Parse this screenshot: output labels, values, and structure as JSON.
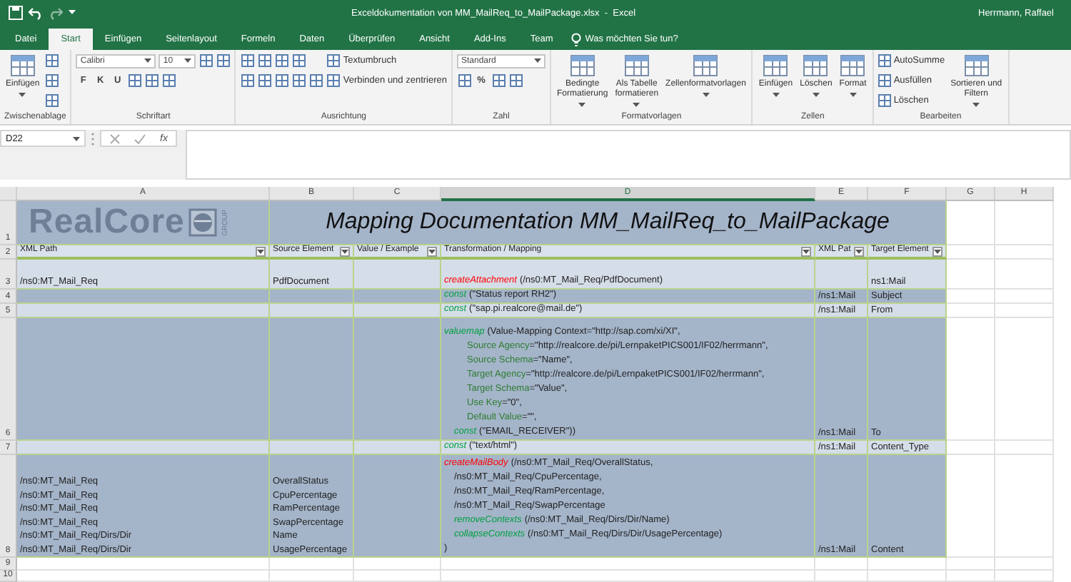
{
  "window": {
    "title": "Exceldokumentation von MM_MailReq_to_MailPackage.xlsx  -  Excel",
    "user": "Herrmann, Raffael"
  },
  "tabs": [
    {
      "label": "Datei",
      "selected": false
    },
    {
      "label": "Start",
      "selected": true
    },
    {
      "label": "Einfügen",
      "selected": false
    },
    {
      "label": "Seitenlayout",
      "selected": false
    },
    {
      "label": "Formeln",
      "selected": false
    },
    {
      "label": "Daten",
      "selected": false
    },
    {
      "label": "Überprüfen",
      "selected": false
    },
    {
      "label": "Ansicht",
      "selected": false
    },
    {
      "label": "Add-Ins",
      "selected": false
    },
    {
      "label": "Team",
      "selected": false
    }
  ],
  "tell_me": {
    "placeholder": "Was möchten Sie tun?"
  },
  "ribbon": {
    "groups": [
      {
        "label": "Zwischenablage",
        "controls": [
          {
            "kind": "big",
            "lines": [
              "Einfügen"
            ]
          },
          {
            "kind": "stack",
            "rows": [
              {
                "items": [
                  {
                    "kind": "tool"
                  }
                ]
              },
              {
                "items": [
                  {
                    "kind": "tool"
                  }
                ]
              },
              {
                "items": [
                  {
                    "kind": "tool"
                  }
                ]
              }
            ]
          }
        ]
      },
      {
        "label": "Schriftart",
        "controls": [
          {
            "kind": "stack",
            "rows": [
              {
                "items": [
                  {
                    "kind": "field",
                    "value": "Calibri"
                  },
                  {
                    "kind": "field",
                    "value": "10"
                  },
                  {
                    "kind": "tool"
                  },
                  {
                    "kind": "tool"
                  }
                ]
              },
              {
                "items": [
                  {
                    "kind": "letter",
                    "text": "F"
                  },
                  {
                    "kind": "letter",
                    "text": "K"
                  },
                  {
                    "kind": "letter",
                    "text": "U"
                  },
                  {
                    "kind": "tool"
                  },
                  {
                    "kind": "tool"
                  },
                  {
                    "kind": "tool"
                  }
                ]
              }
            ]
          }
        ]
      },
      {
        "label": "Ausrichtung",
        "controls": [
          {
            "kind": "stack",
            "rows": [
              {
                "items": [
                  {
                    "kind": "tool"
                  },
                  {
                    "kind": "tool"
                  },
                  {
                    "kind": "tool"
                  },
                  {
                    "kind": "tool"
                  }
                ]
              },
              {
                "items": [
                  {
                    "kind": "tool"
                  },
                  {
                    "kind": "tool"
                  },
                  {
                    "kind": "tool"
                  },
                  {
                    "kind": "tool"
                  },
                  {
                    "kind": "tool"
                  }
                ]
              }
            ]
          },
          {
            "kind": "stack",
            "rows": [
              {
                "items": [
                  {
                    "kind": "small",
                    "label": "Textumbruch"
                  }
                ]
              },
              {
                "items": [
                  {
                    "kind": "small",
                    "label": "Verbinden und zentrieren"
                  }
                ]
              }
            ]
          }
        ]
      },
      {
        "label": "Zahl",
        "controls": [
          {
            "kind": "stack",
            "rows": [
              {
                "items": [
                  {
                    "kind": "field",
                    "value": "Standard"
                  }
                ]
              },
              {
                "items": [
                  {
                    "kind": "tool"
                  },
                  {
                    "kind": "letter",
                    "text": "%"
                  },
                  {
                    "kind": "tool"
                  },
                  {
                    "kind": "tool"
                  }
                ]
              }
            ]
          }
        ]
      },
      {
        "label": "Formatvorlagen",
        "controls": [
          {
            "kind": "big",
            "lines": [
              "Bedingte",
              "Formatierung"
            ]
          },
          {
            "kind": "big",
            "lines": [
              "Als Tabelle",
              "formatieren"
            ]
          },
          {
            "kind": "big",
            "lines": [
              "Zellenformatvorlagen"
            ]
          }
        ]
      },
      {
        "label": "Zellen",
        "controls": [
          {
            "kind": "big",
            "lines": [
              "Einfügen"
            ]
          },
          {
            "kind": "big",
            "lines": [
              "Löschen"
            ]
          },
          {
            "kind": "big",
            "lines": [
              "Format"
            ]
          }
        ]
      },
      {
        "label": "Bearbeiten",
        "controls": [
          {
            "kind": "stack",
            "rows": [
              {
                "items": [
                  {
                    "kind": "small",
                    "label": "AutoSumme"
                  }
                ]
              },
              {
                "items": [
                  {
                    "kind": "small",
                    "label": "Ausfüllen"
                  }
                ]
              },
              {
                "items": [
                  {
                    "kind": "small",
                    "label": "Löschen"
                  }
                ]
              }
            ]
          },
          {
            "kind": "big",
            "lines": [
              "Sortieren und",
              "Filtern"
            ]
          }
        ]
      }
    ]
  },
  "formula_bar": {
    "name_box": "D22",
    "function_button": "fx"
  },
  "sheet": {
    "columns": [
      {
        "label": "A",
        "selected": false
      },
      {
        "label": "B",
        "selected": false
      },
      {
        "label": "C",
        "selected": false
      },
      {
        "label": "D",
        "selected": true
      },
      {
        "label": "E",
        "selected": false
      },
      {
        "label": "F",
        "selected": false
      },
      {
        "label": "G",
        "selected": false
      },
      {
        "label": "H",
        "selected": false
      }
    ],
    "rows": [
      {
        "number": "1",
        "kind": "banner",
        "logo": {
          "wordmark": "RealCore",
          "tagline": "GROUP"
        },
        "title": "Mapping Documentation MM_MailReq_to_MailPackage"
      },
      {
        "number": "2",
        "kind": "header",
        "cells": [
          "XML Path",
          "Source Element",
          "Value / Example",
          "Transformation / Mapping",
          "XML Pat",
          "Target Element"
        ]
      },
      {
        "number": "3",
        "kind": "data",
        "xml_path": [
          "/ns0:MT_Mail_Req"
        ],
        "source_element": [
          "PdfDocument"
        ],
        "mapping": [
          {
            "kind": "call",
            "func": "createAttachment",
            "color": "#ff0000",
            "args": "(/ns0:MT_Mail_Req/PdfDocument)"
          }
        ],
        "target_element": "ns1:Mail"
      },
      {
        "number": "4",
        "kind": "data",
        "mapping": [
          {
            "kind": "call",
            "func": "const",
            "color": "#00a040",
            "args": "(\"Status report RH2\")"
          }
        ],
        "target_path": "/ns1:Mail",
        "target_element": "Subject"
      },
      {
        "number": "5",
        "kind": "data",
        "mapping": [
          {
            "kind": "call",
            "func": "const",
            "color": "#00a040",
            "args": "(\"sap.pi.realcore@mail.de\")"
          }
        ],
        "target_path": "/ns1:Mail",
        "target_element": "From"
      },
      {
        "number": "6",
        "kind": "data",
        "mapping": [
          {
            "kind": "call",
            "func": "valuemap",
            "color": "#00a040",
            "args": "(Value-Mapping Context=\"http://sap.com/xi/XI\","
          },
          {
            "kind": "param",
            "name": "Source Agency",
            "value": "=\"http://realcore.de/pi/LernpaketPICS001/IF02/herrmann\","
          },
          {
            "kind": "param",
            "name": "Source Schema",
            "value": "=\"Name\","
          },
          {
            "kind": "param",
            "name": "Target Agency",
            "value": "=\"http://realcore.de/pi/LernpaketPICS001/IF02/herrmann\","
          },
          {
            "kind": "param",
            "name": "Target Schema",
            "value": "=\"Value\","
          },
          {
            "kind": "param",
            "name": "Use Key",
            "value": "=\"0\","
          },
          {
            "kind": "param",
            "name": "Default Value",
            "value": "=\"\","
          },
          {
            "kind": "nested_call",
            "func": "const",
            "color": "#00a040",
            "args": "(\"EMAIL_RECEIVER\"))"
          }
        ],
        "target_path": "/ns1:Mail",
        "target_element": "To"
      },
      {
        "number": "7",
        "kind": "data",
        "mapping": [
          {
            "kind": "call",
            "func": "const",
            "color": "#00a040",
            "args": "(\"text/html\")"
          }
        ],
        "target_path": "/ns1:Mail",
        "target_element": "Content_Type"
      },
      {
        "number": "8",
        "kind": "data",
        "xml_path": [
          "/ns0:MT_Mail_Req",
          "/ns0:MT_Mail_Req",
          "/ns0:MT_Mail_Req",
          "/ns0:MT_Mail_Req",
          "/ns0:MT_Mail_Req/Dirs/Dir",
          "/ns0:MT_Mail_Req/Dirs/Dir"
        ],
        "source_element": [
          "OverallStatus",
          "CpuPercentage",
          "RamPercentage",
          "SwapPercentage",
          "Name",
          "UsagePercentage"
        ],
        "mapping": [
          {
            "kind": "call",
            "func": "createMailBody",
            "color": "#ff0000",
            "args": "(/ns0:MT_Mail_Req/OverallStatus,"
          },
          {
            "kind": "path",
            "text": "/ns0:MT_Mail_Req/CpuPercentage,"
          },
          {
            "kind": "path",
            "text": "/ns0:MT_Mail_Req/RamPercentage,"
          },
          {
            "kind": "path",
            "text": "/ns0:MT_Mail_Req/SwapPercentage"
          },
          {
            "kind": "nested_call",
            "func": "removeContexts",
            "color": "#00a040",
            "args": "(/ns0:MT_Mail_Req/Dirs/Dir/Name)"
          },
          {
            "kind": "nested_call",
            "func": "collapseContexts",
            "color": "#00a040",
            "args": "(/ns0:MT_Mail_Req/Dirs/Dir/UsagePercentage)"
          },
          {
            "kind": "plain",
            "text": ")"
          }
        ],
        "target_path": "/ns1:Mail",
        "target_element": "Content"
      },
      {
        "number": "9",
        "kind": "empty"
      },
      {
        "number": "10",
        "kind": "empty"
      }
    ]
  }
}
